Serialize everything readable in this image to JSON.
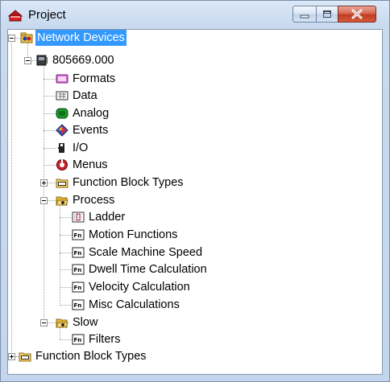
{
  "window": {
    "title": "Project",
    "controls": {
      "minimize": "minimize",
      "maximize": "maximize",
      "close": "close"
    }
  },
  "tree": {
    "root": {
      "label": "Network Devices",
      "expanded": true,
      "selected": true
    },
    "device": {
      "label": "805669.000",
      "expanded": true
    },
    "items": {
      "formats": "Formats",
      "data": "Data",
      "analog": "Analog",
      "events": "Events",
      "io": "I/O",
      "menus": "Menus",
      "fbt_inner": "Function Block Types",
      "process": "Process",
      "ladder": "Ladder",
      "motion": "Motion Functions",
      "scale": "Scale Machine Speed",
      "dwell": "Dwell Time Calculation",
      "velocity": "Velocity Calculation",
      "misc": "Misc Calculations",
      "slow": "Slow",
      "filters": "Filters",
      "fbt_outer": "Function Block Types"
    }
  },
  "colors": {
    "selection": "#3399ff",
    "close_button": "#c23d22"
  }
}
